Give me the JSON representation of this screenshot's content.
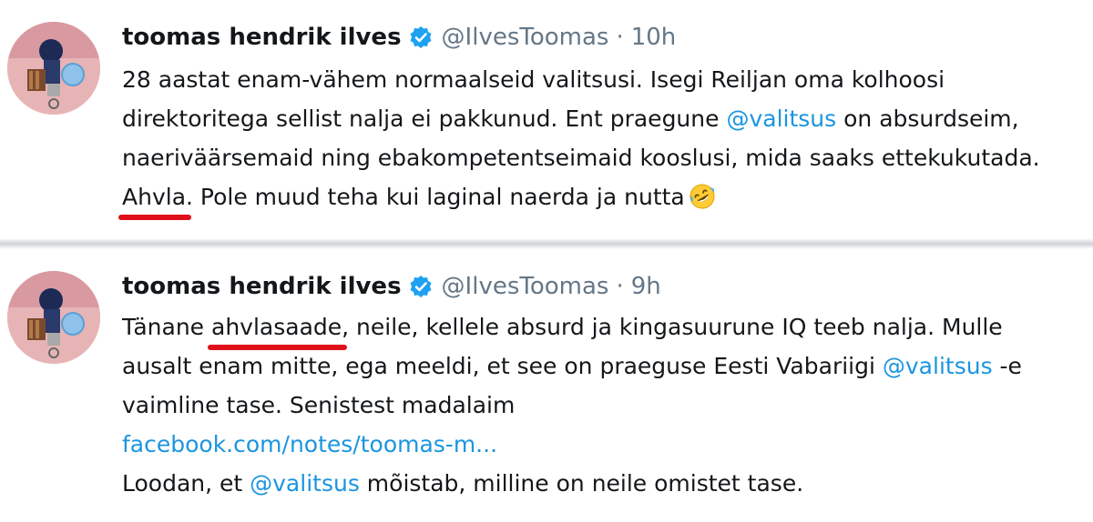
{
  "tweets": [
    {
      "author_name": "toomas hendrik ilves",
      "handle": "@IlvesToomas",
      "separator": "·",
      "time": "10h",
      "lines": {
        "l1": "28 aastat enam-vähem normaalseid valitsusi. Isegi Reiljan oma kolhoosi",
        "l2a": "direktoritega sellist nalja ei pakkunud. Ent praegune ",
        "l2b": "@valitsus",
        "l2c": " on absurdseim,",
        "l3": "naeriväärsemaid ning ebakompetentseimaid kooslusi, mida saaks ettekukutada.",
        "l4a": "Ahvla",
        "l4b": ". Pole muud teha kui laginal naerda ja nutta"
      },
      "emoji": "rolling-on-floor-laughing-emoji"
    },
    {
      "author_name": "toomas hendrik ilves",
      "handle": "@IlvesToomas",
      "separator": "·",
      "time": "9h",
      "lines": {
        "l1a": "Tänane ",
        "l1b": "ahvlasaade",
        "l1c": ", neile, kellele absurd ja kingasuurune IQ teeb nalja. Mulle",
        "l2a": "ausalt enam mitte, ega meeldi, et see on praeguse Eesti Vabariigi ",
        "l2b": "@valitsus",
        "l2c": " -e",
        "l3": "vaimline tase. Senistest madalaim",
        "l4": "facebook.com/notes/toomas-m...",
        "l5a": "Loodan, et ",
        "l5b": "@valitsus",
        "l5c": " mõistab, milline on neile omistet tase."
      }
    }
  ],
  "colors": {
    "link": "#1b95e0",
    "muted": "#657786",
    "verified": "#1da1f2",
    "underline_highlight": "#e0101a"
  },
  "icons": {
    "verified": "verified-badge-icon",
    "avatar": "avatar"
  }
}
